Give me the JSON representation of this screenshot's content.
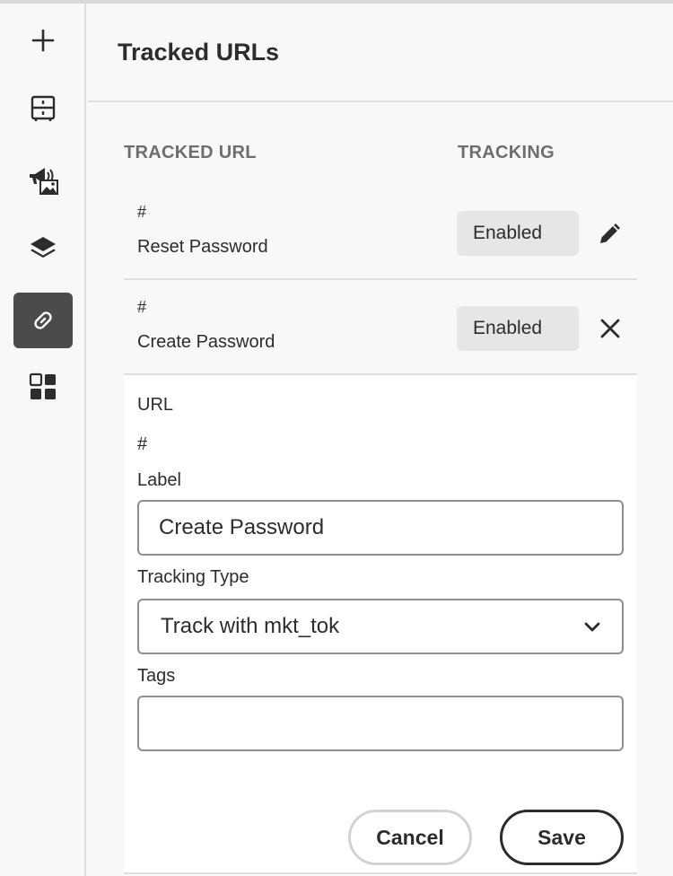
{
  "rail": {
    "items": [
      {
        "icon": "plus-icon"
      },
      {
        "icon": "cabinet-icon"
      },
      {
        "icon": "megaphone-image-icon"
      },
      {
        "icon": "layers-icon"
      },
      {
        "icon": "link-icon",
        "active": true
      },
      {
        "icon": "grid-icon"
      }
    ]
  },
  "panel": {
    "title": "Tracked URLs",
    "columns": {
      "url": "TRACKED URL",
      "tracking": "TRACKING"
    }
  },
  "rows": [
    {
      "url": "#",
      "label": "Reset Password",
      "tracking": "Enabled",
      "action": "pencil-icon"
    },
    {
      "url": "#",
      "label": "Create Password",
      "tracking": "Enabled",
      "action": "close-icon"
    }
  ],
  "edit": {
    "url_label": "URL",
    "url_value": "#",
    "label_label": "Label",
    "label_value": "Create Password",
    "tracking_type_label": "Tracking Type",
    "tracking_type_value": "Track with mkt_tok",
    "tags_label": "Tags",
    "tags_value": "",
    "cancel": "Cancel",
    "save": "Save"
  },
  "colors": {
    "accent_dark": "#4b4b4b",
    "badge_bg": "#e6e6e6",
    "border": "#dedede",
    "text": "#2c2c2c"
  }
}
